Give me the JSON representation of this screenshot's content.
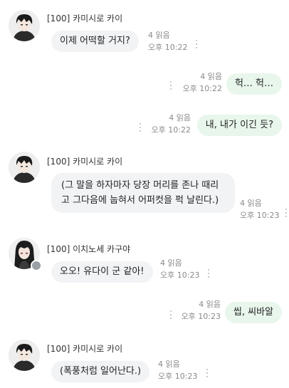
{
  "messages": [
    {
      "sender": "[100] 카미시로 카이",
      "text": "이제 어떡할 거지?",
      "reads": "4 읽음",
      "time": "오후 10:22",
      "avatar_icon": "dark-haired-boy-avatar"
    },
    {
      "text": "헉… 헉…",
      "reads": "4 읽음",
      "time": "오후 10:22"
    },
    {
      "text": "내, 내가 이긴 듯?",
      "reads": "4 읽음",
      "time": "오후 10:22"
    },
    {
      "sender": "[100] 카미시로 카이",
      "text": "(그 말을 하자마자 당장 머리를 존나 때리고 그다음에 눕혀서 어퍼컷을 퍽 날린다.)",
      "reads": "4 읽음",
      "time": "오후 10:23",
      "avatar_icon": "dark-haired-boy-avatar"
    },
    {
      "sender": "[100] 이치노세 카구야",
      "text": "오오! 유다이 군 같아!",
      "reads": "4 읽음",
      "time": "오후 10:23",
      "avatar_icon": "long-haired-girl-avatar"
    },
    {
      "text": "씹, 씨바알",
      "reads": "4 읽음",
      "time": "오후 10:23"
    },
    {
      "sender": "[100] 카미시로 카이",
      "text": "(폭풍처럼 일어난다.)",
      "reads": "4 읽음",
      "time": "오후 10:23",
      "avatar_icon": "dark-haired-boy-avatar"
    }
  ],
  "colors": {
    "incoming_bubble": "#f2f3f5",
    "outgoing_bubble": "#e8f6ec",
    "meta_text": "#8a8a8a"
  }
}
